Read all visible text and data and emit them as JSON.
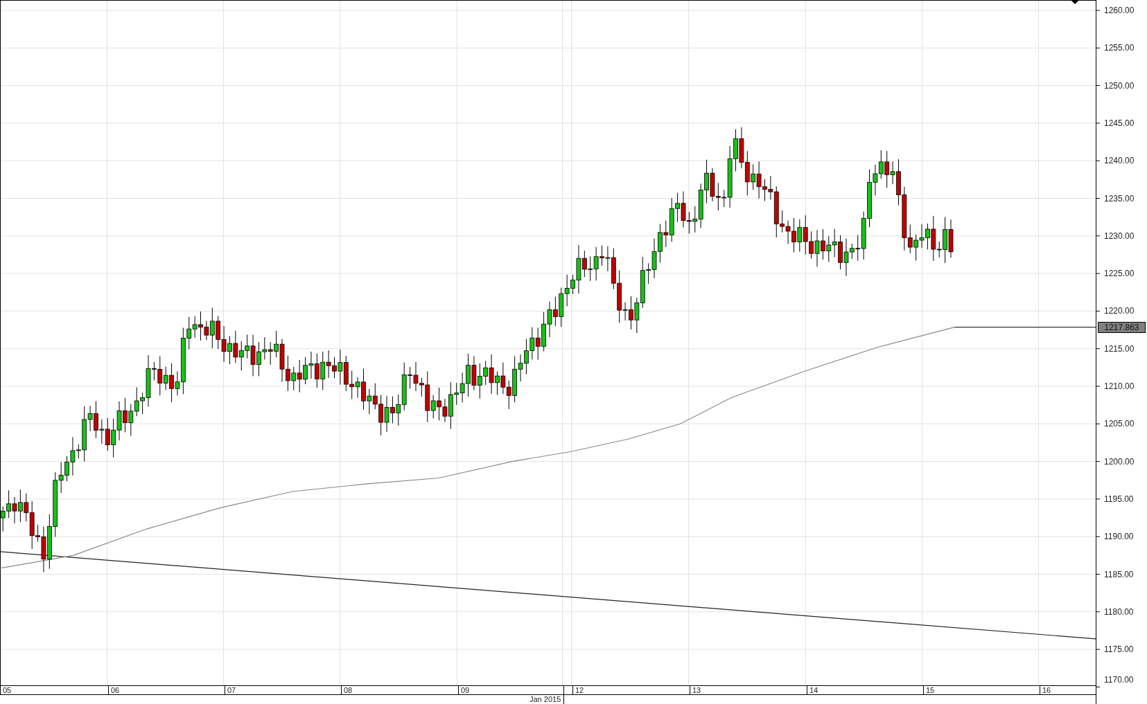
{
  "price_axis": {
    "ticks": [
      "1260.00",
      "1255.00",
      "1250.00",
      "1245.00",
      "1240.00",
      "1235.00",
      "1230.00",
      "1225.00",
      "1220.00",
      "1215.00",
      "1210.00",
      "1205.00",
      "1200.00",
      "1195.00",
      "1190.00",
      "1185.00",
      "1180.00",
      "1175.00",
      "1170.00"
    ],
    "current_price": "1217.863"
  },
  "time_axis": {
    "days": [
      "05",
      "06",
      "07",
      "08",
      "09",
      "12",
      "13",
      "14",
      "15",
      "16"
    ],
    "month": "Jan 2015"
  }
}
